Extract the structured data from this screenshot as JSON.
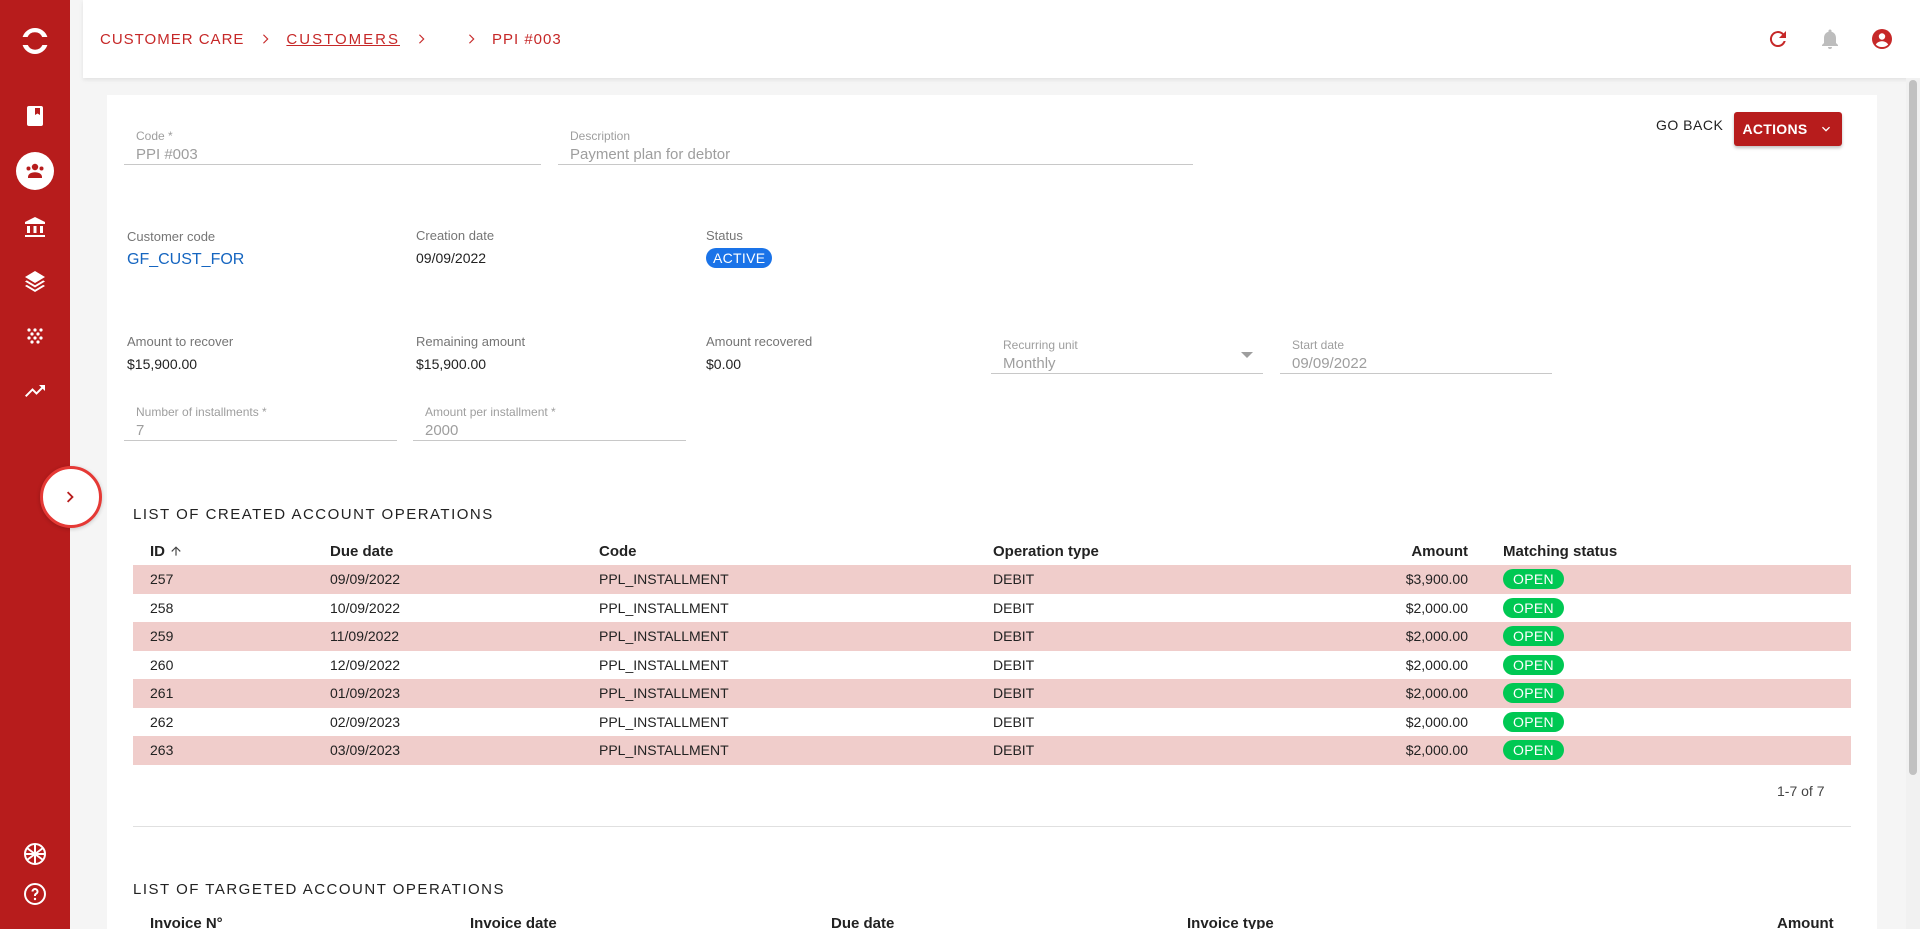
{
  "sidebar": {
    "icons": [
      "logo-icon",
      "book-icon",
      "customers-icon",
      "bank-icon",
      "layers-icon",
      "dots-icon",
      "trending-up-icon",
      "language-flag-icon",
      "help-icon",
      "chevron-right-icon"
    ]
  },
  "breadcrumb": {
    "items": [
      "CUSTOMER CARE",
      "CUSTOMERS",
      "PPI #003"
    ]
  },
  "header": {
    "icons": [
      "refresh-icon",
      "bell-icon",
      "account-icon"
    ]
  },
  "form": {
    "code": {
      "label": "Code *",
      "value": "PPI #003"
    },
    "description": {
      "label": "Description",
      "value": "Payment plan for debtor"
    },
    "customer_code": {
      "label": "Customer code",
      "value": "GF_CUST_FOR"
    },
    "creation_date": {
      "label": "Creation date",
      "value": "09/09/2022"
    },
    "status": {
      "label": "Status",
      "value": "ACTIVE"
    },
    "amount_to_recover": {
      "label": "Amount to recover",
      "value": "$15,900.00"
    },
    "remaining_amount": {
      "label": "Remaining amount",
      "value": "$15,900.00"
    },
    "amount_recovered": {
      "label": "Amount recovered",
      "value": "$0.00"
    },
    "recurring_unit": {
      "label": "Recurring unit",
      "value": "Monthly"
    },
    "start_date": {
      "label": "Start date",
      "value": "09/09/2022"
    },
    "installments": {
      "label": "Number of installments *",
      "value": "7"
    },
    "amount_per_installment": {
      "label": "Amount per installment *",
      "value": "2000"
    }
  },
  "actions": {
    "go_back": "GO BACK",
    "actions": "ACTIONS"
  },
  "created_ops": {
    "title": "LIST OF CREATED ACCOUNT OPERATIONS",
    "columns": [
      "ID",
      "Due date",
      "Code",
      "Operation type",
      "Amount",
      "Matching status"
    ],
    "rows": [
      [
        "257",
        "09/09/2022",
        "PPL_INSTALLMENT",
        "DEBIT",
        "$3,900.00",
        "OPEN"
      ],
      [
        "258",
        "10/09/2022",
        "PPL_INSTALLMENT",
        "DEBIT",
        "$2,000.00",
        "OPEN"
      ],
      [
        "259",
        "11/09/2022",
        "PPL_INSTALLMENT",
        "DEBIT",
        "$2,000.00",
        "OPEN"
      ],
      [
        "260",
        "12/09/2022",
        "PPL_INSTALLMENT",
        "DEBIT",
        "$2,000.00",
        "OPEN"
      ],
      [
        "261",
        "01/09/2023",
        "PPL_INSTALLMENT",
        "DEBIT",
        "$2,000.00",
        "OPEN"
      ],
      [
        "262",
        "02/09/2023",
        "PPL_INSTALLMENT",
        "DEBIT",
        "$2,000.00",
        "OPEN"
      ],
      [
        "263",
        "03/09/2023",
        "PPL_INSTALLMENT",
        "DEBIT",
        "$2,000.00",
        "OPEN"
      ]
    ],
    "pagination": "1-7 of 7"
  },
  "targeted_ops": {
    "title": "LIST OF TARGETED ACCOUNT OPERATIONS",
    "columns": [
      "Invoice N°",
      "Invoice date",
      "Due date",
      "Invoice type",
      "Amount"
    ]
  },
  "colors": {
    "brand": "#b71c1c",
    "row_highlight": "#f0cdcb",
    "active_badge": "#1a73e8",
    "open_badge": "#00c853"
  }
}
